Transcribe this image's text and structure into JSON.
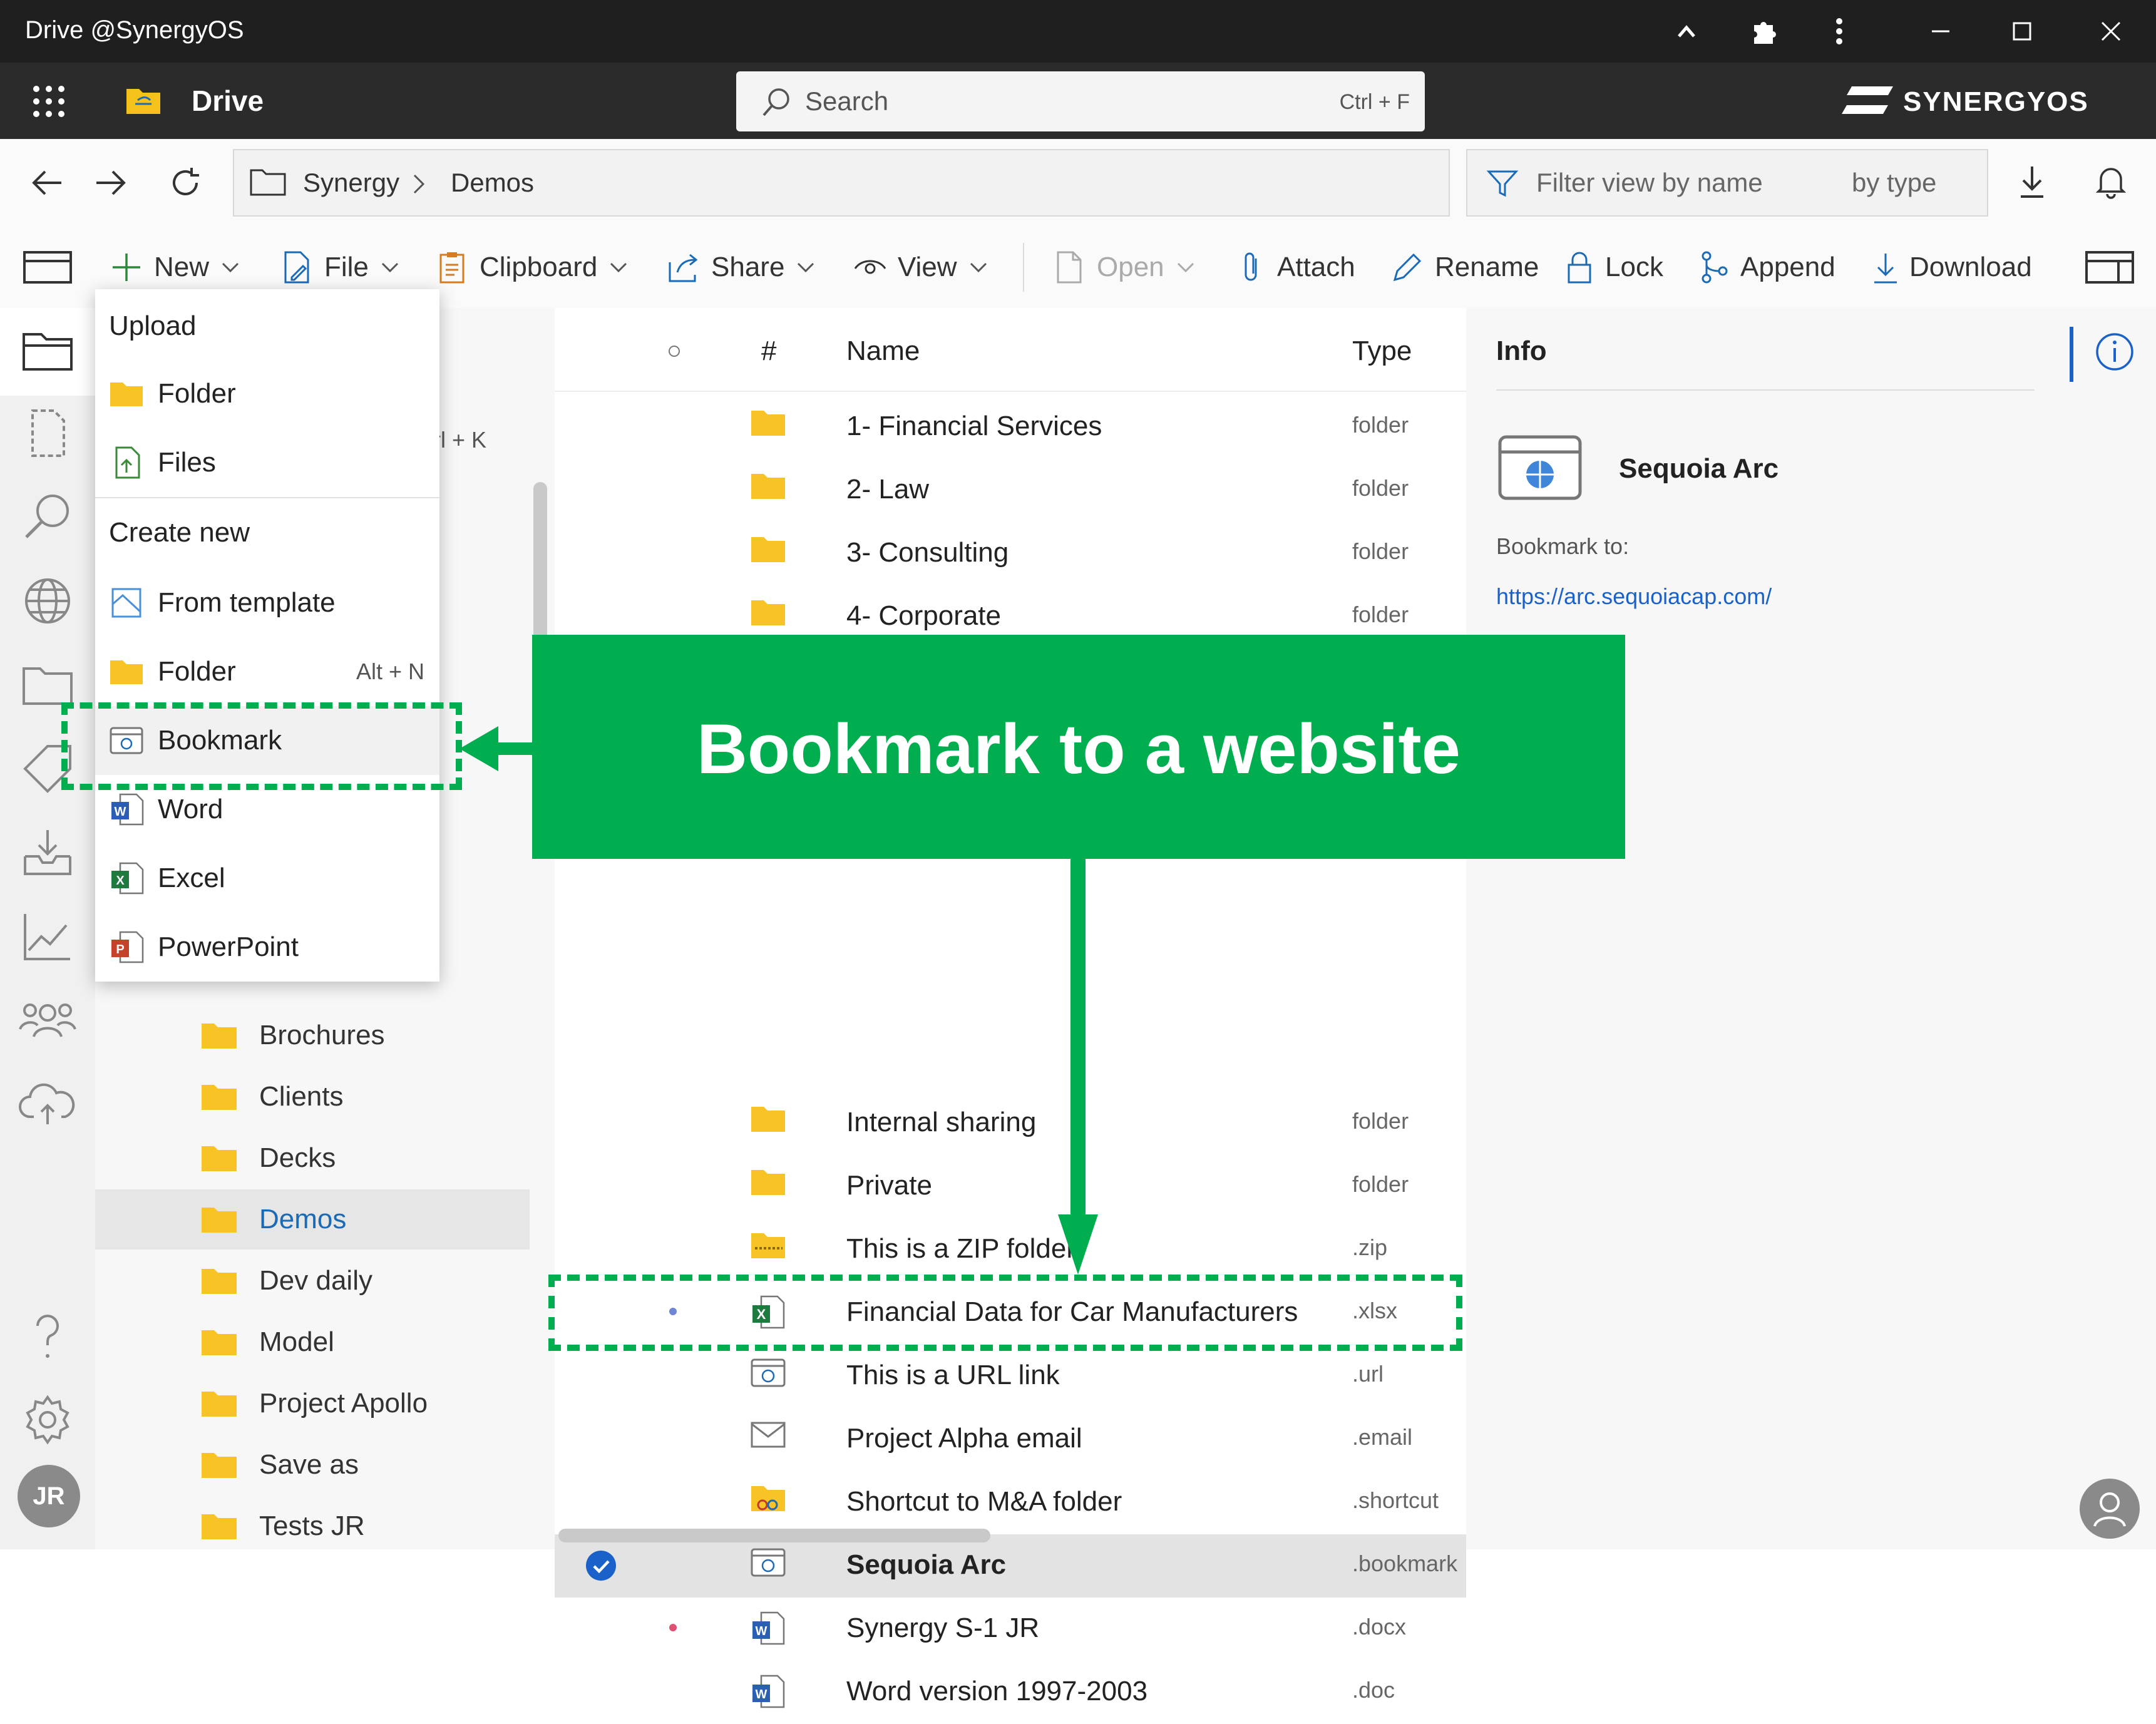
{
  "window": {
    "title": "Drive @SynergyOS"
  },
  "app": {
    "name": "Drive",
    "brand": "SYNERGYOS",
    "search_placeholder": "Search",
    "search_shortcut": "Ctrl + F"
  },
  "breadcrumb": {
    "items": [
      "Synergy",
      "Demos"
    ]
  },
  "filter": {
    "placeholder": "Filter view by name",
    "type_label": "by type"
  },
  "toolbar": {
    "new": "New",
    "file": "File",
    "clipboard": "Clipboard",
    "share": "Share",
    "view": "View",
    "open": "Open",
    "attach": "Attach",
    "rename": "Rename",
    "lock": "Lock",
    "append": "Append",
    "download": "Download"
  },
  "new_menu": {
    "upload_header": "Upload",
    "upload_items": [
      "Folder",
      "Files"
    ],
    "create_header": "Create new",
    "create_items": [
      {
        "label": "From template",
        "shortcut": ""
      },
      {
        "label": "Folder",
        "shortcut": "Alt + N"
      },
      {
        "label": "Bookmark",
        "shortcut": ""
      },
      {
        "label": "Word",
        "shortcut": ""
      },
      {
        "label": "Excel",
        "shortcut": ""
      },
      {
        "label": "PowerPoint",
        "shortcut": ""
      }
    ]
  },
  "hidden_shortcut_fragment": "rl + K",
  "tree": {
    "items": [
      {
        "label": "Brochures",
        "selected": false
      },
      {
        "label": "Clients",
        "selected": false
      },
      {
        "label": "Decks",
        "selected": false
      },
      {
        "label": "Demos",
        "selected": true
      },
      {
        "label": "Dev daily",
        "selected": false
      },
      {
        "label": "Model",
        "selected": false
      },
      {
        "label": "Project Apollo",
        "selected": false
      },
      {
        "label": "Save as",
        "selected": false
      },
      {
        "label": "Tests JR",
        "selected": false
      }
    ]
  },
  "list": {
    "headers": {
      "hash": "#",
      "name": "Name",
      "type": "Type"
    },
    "rows": [
      {
        "name": "1- Financial Services",
        "type": "folder",
        "icon": "folder-icon"
      },
      {
        "name": "2- Law",
        "type": "folder",
        "icon": "folder-icon"
      },
      {
        "name": "3- Consulting",
        "type": "folder",
        "icon": "folder-icon"
      },
      {
        "name": "4- Corporate",
        "type": "folder",
        "icon": "folder-icon"
      },
      {
        "name": "Internal sharing",
        "type": "folder",
        "icon": "folder-icon"
      },
      {
        "name": "Private",
        "type": "folder",
        "icon": "folder-icon"
      },
      {
        "name": "This is a ZIP folder",
        "type": ".zip",
        "icon": "zip-folder-icon"
      },
      {
        "name": "Financial Data for Car Manufacturers",
        "type": ".xlsx",
        "icon": "excel-file-icon"
      },
      {
        "name": "This is a URL link",
        "type": ".url",
        "icon": "url-link-icon"
      },
      {
        "name": "Project Alpha email",
        "type": ".email",
        "icon": "email-icon"
      },
      {
        "name": "Shortcut to M&A folder",
        "type": ".shortcut",
        "icon": "shortcut-folder-icon"
      },
      {
        "name": "Sequoia Arc",
        "type": ".bookmark",
        "icon": "bookmark-icon"
      },
      {
        "name": "Synergy S-1 JR",
        "type": ".docx",
        "icon": "word-file-icon"
      },
      {
        "name": "Word version 1997-2003",
        "type": ".doc",
        "icon": "word-file-icon"
      }
    ]
  },
  "info": {
    "title": "Info",
    "item_name": "Sequoia Arc",
    "bookmark_label": "Bookmark to:",
    "bookmark_url": "https://arc.sequoiacap.com/"
  },
  "annotation": {
    "callout": "Bookmark to a website"
  },
  "user": {
    "initials": "JR"
  },
  "colors": {
    "accent_green": "#00ad4f",
    "link_blue": "#1a62c9",
    "selected_blue": "#1b6ab5"
  }
}
